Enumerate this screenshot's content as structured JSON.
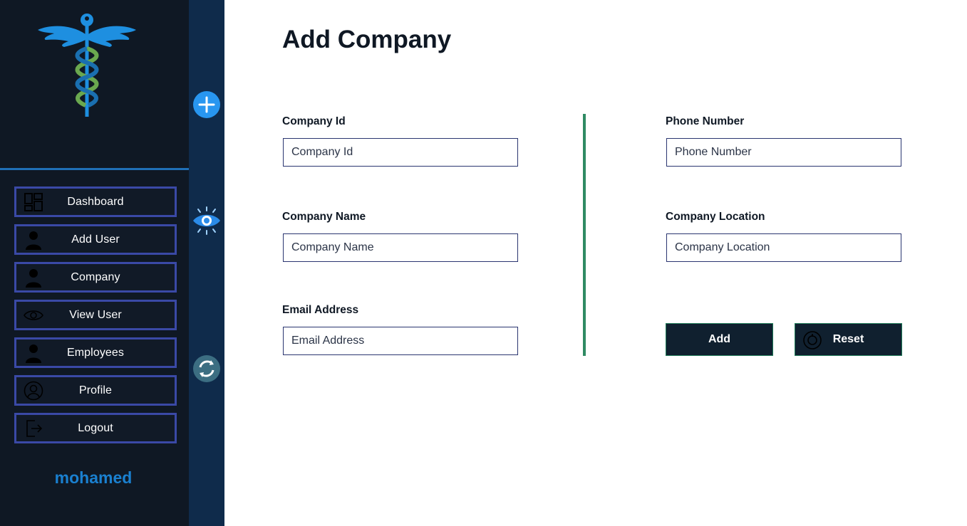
{
  "sidebar": {
    "logo_icon": "caduceus-icon",
    "items": [
      {
        "label": "Dashboard",
        "icon": "dashboard-icon"
      },
      {
        "label": "Add User",
        "icon": "user-icon"
      },
      {
        "label": "Company",
        "icon": "user-icon"
      },
      {
        "label": "View User",
        "icon": "eye-icon"
      },
      {
        "label": "Employees",
        "icon": "user-icon"
      },
      {
        "label": "Profile",
        "icon": "profile-icon"
      },
      {
        "label": "Logout",
        "icon": "logout-icon"
      }
    ],
    "username": "mohamed"
  },
  "rail": {
    "buttons": [
      {
        "icon": "plus-circle-icon"
      },
      {
        "icon": "eye-icon"
      },
      {
        "icon": "refresh-icon"
      }
    ]
  },
  "main": {
    "title": "Add Company",
    "form": {
      "company_id": {
        "label": "Company Id",
        "placeholder": "Company Id",
        "value": ""
      },
      "company_name": {
        "label": "Company Name",
        "placeholder": "Company Name",
        "value": ""
      },
      "email": {
        "label": "Email Address",
        "placeholder": "Email Address",
        "value": ""
      },
      "phone": {
        "label": "Phone Number",
        "placeholder": "Phone Number",
        "value": ""
      },
      "location": {
        "label": "Company Location",
        "placeholder": "Company Location",
        "value": ""
      }
    },
    "buttons": {
      "add_label": "Add",
      "reset_label": "Reset"
    }
  },
  "colors": {
    "sidebar_bg": "#0f1824",
    "rail_bg": "#0f2b4b",
    "nav_border": "#3a49a6",
    "accent_blue": "#1a80d0",
    "divider_green": "#2f8b63",
    "title_text": "#0f1824"
  }
}
